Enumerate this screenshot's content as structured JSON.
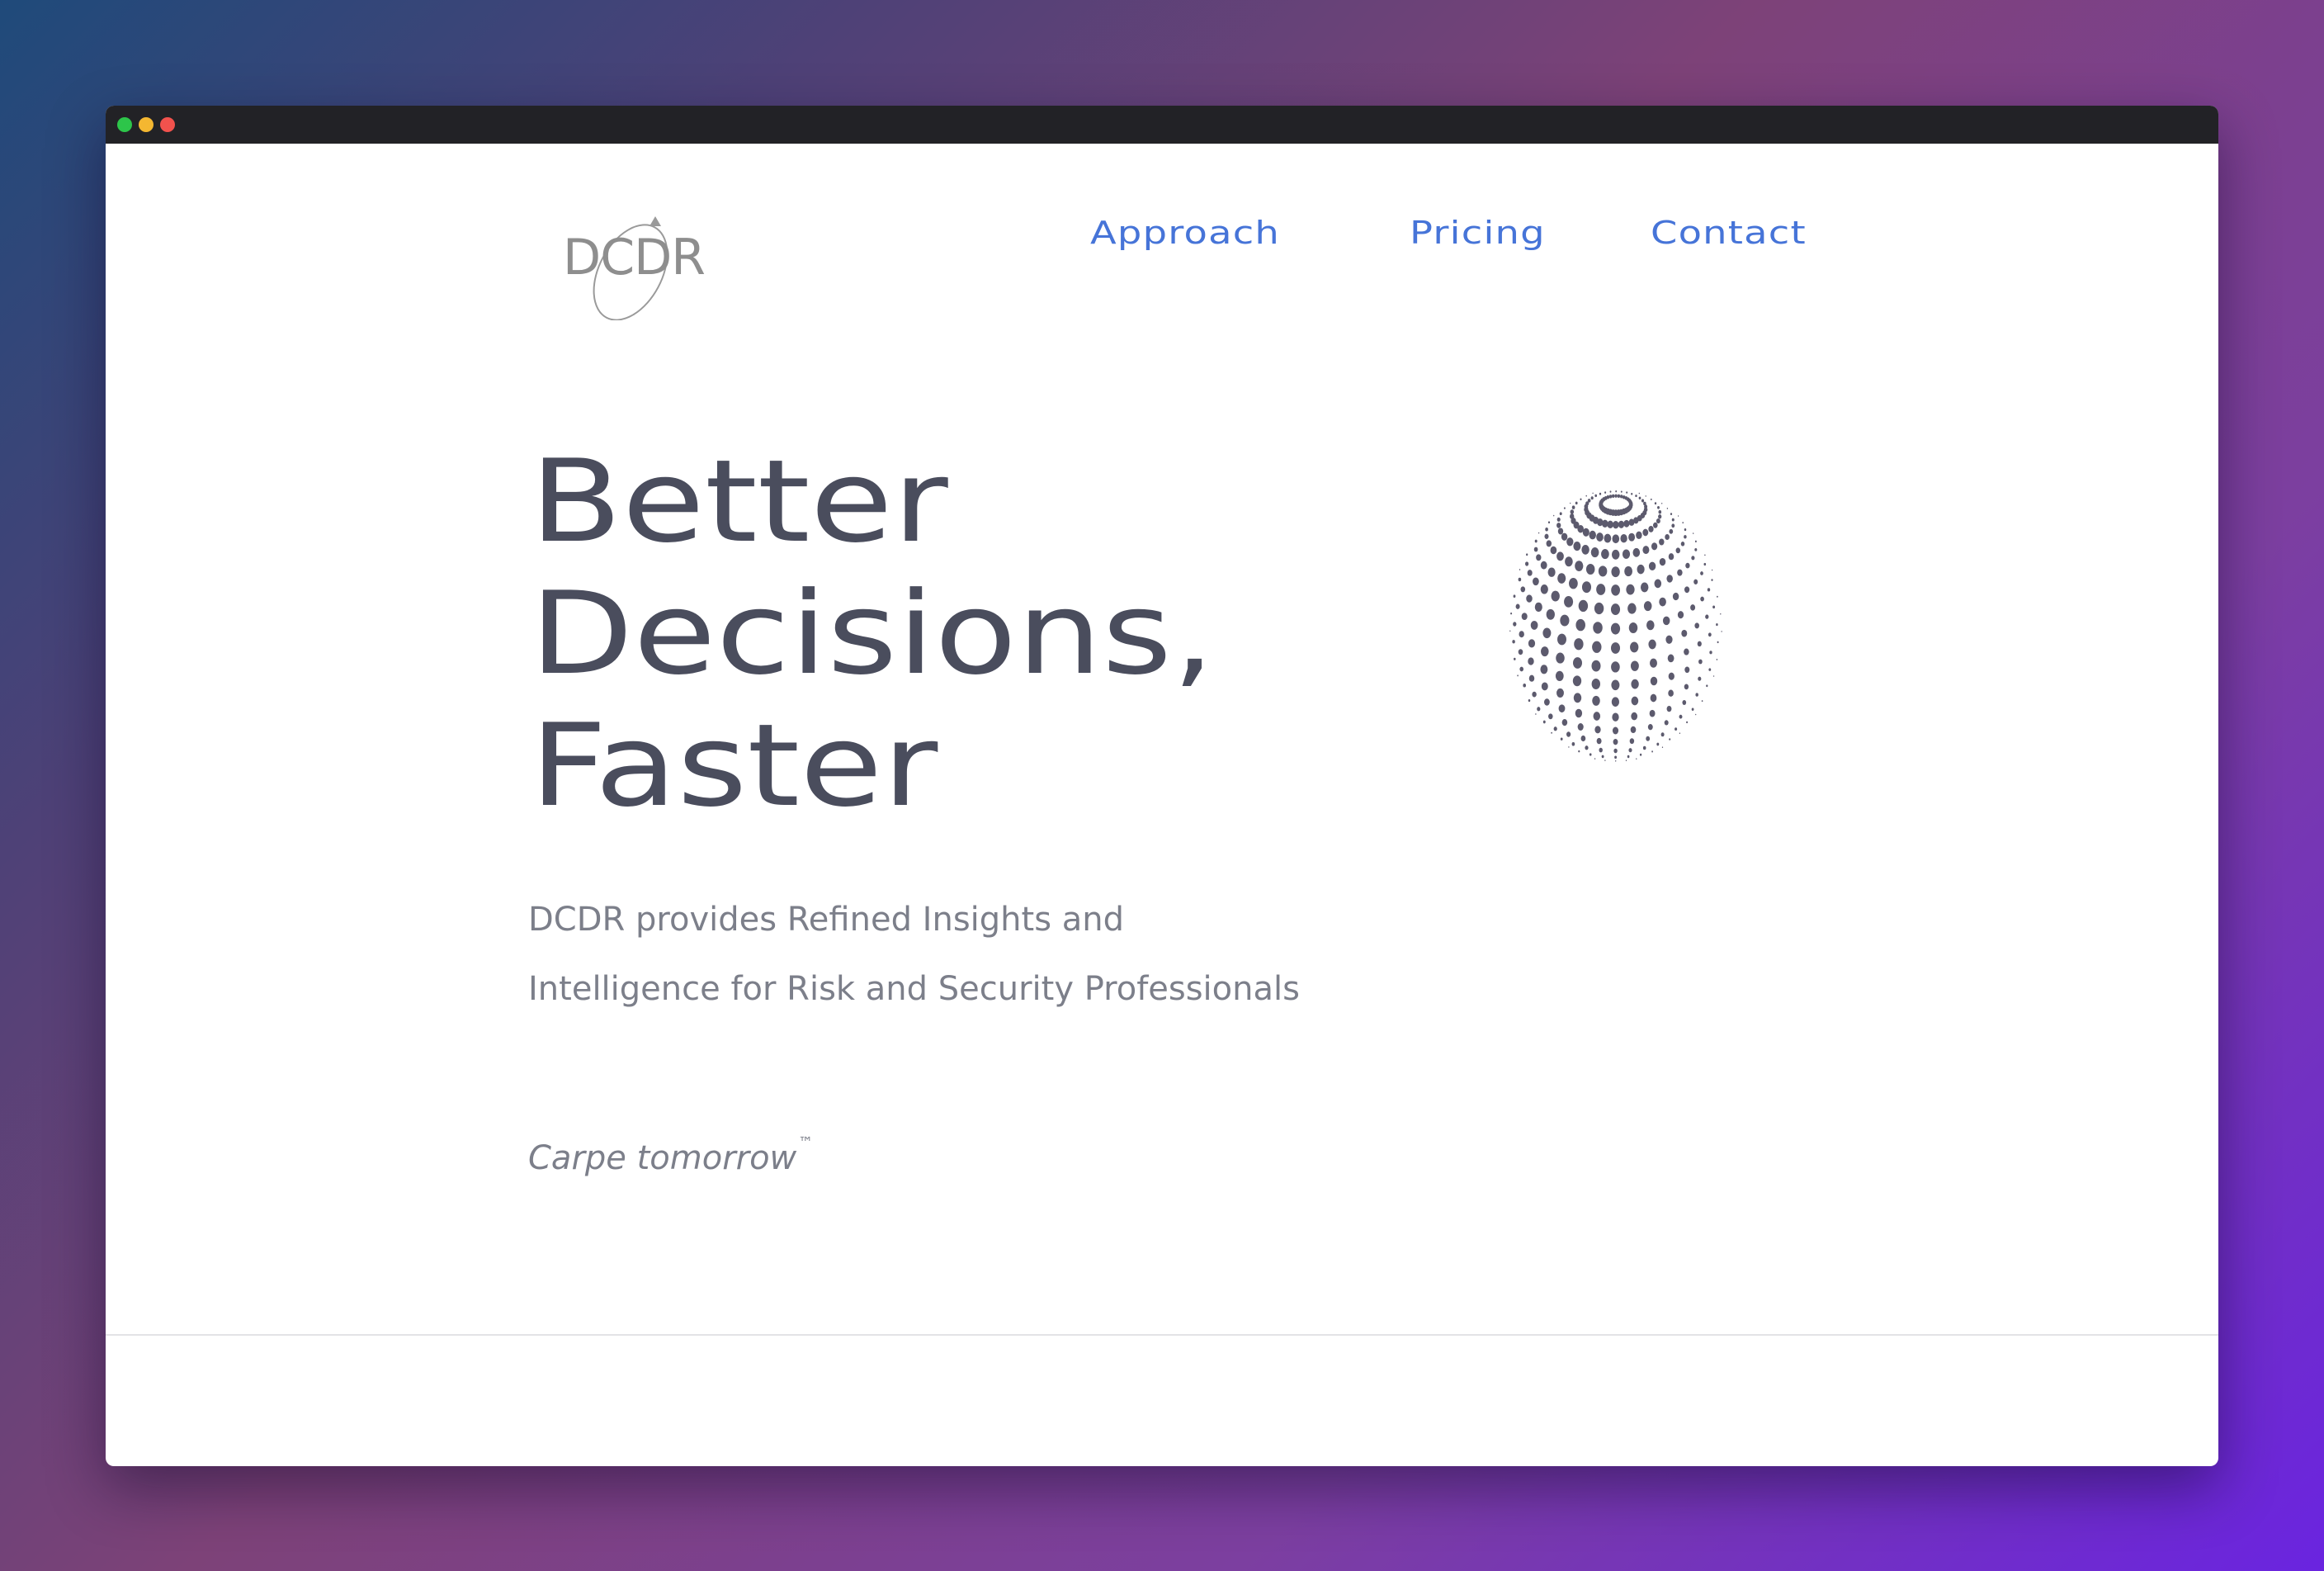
{
  "window": {
    "controls": [
      "close",
      "minimize",
      "maximize"
    ]
  },
  "logo": {
    "text": "DCDR"
  },
  "nav": {
    "items": [
      {
        "label": "Approach"
      },
      {
        "label": "Pricing"
      },
      {
        "label": "Contact"
      }
    ]
  },
  "hero": {
    "headline_lines": [
      "Better",
      "Decisions,",
      "Faster"
    ],
    "subtitle_lines": [
      "DCDR provides Refined Insights and",
      "Intelligence for Risk and Security Professionals"
    ],
    "tagline": "Carpe tomorrow",
    "tagline_mark": "™"
  },
  "colors": {
    "nav_link": "#4674d8",
    "headline": "#4a4d5d",
    "body_text": "#7c7f8a",
    "sphere_dots": "#5c5a6d",
    "window_bar": "#222226"
  },
  "icons": {
    "hero_graphic": "dotted-sphere-icon"
  }
}
